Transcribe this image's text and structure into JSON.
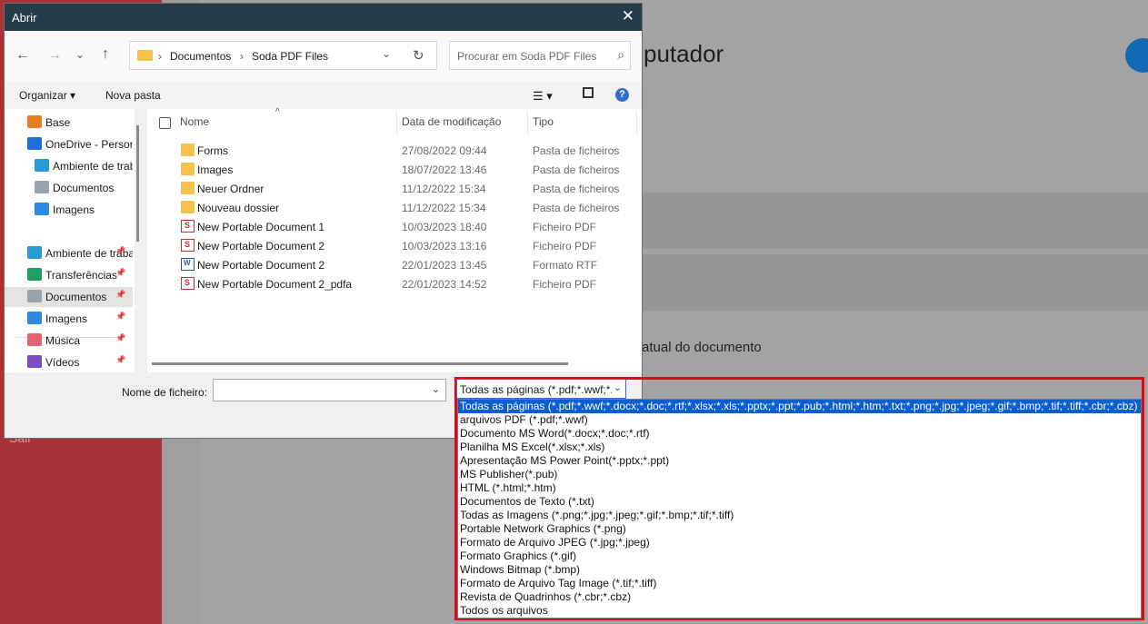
{
  "background": {
    "title_fragment": "putador",
    "text_fragment": "atual do documento",
    "sidebar_fragment": "Sair",
    "accent": "#a8323a",
    "button_color": "#1469b4"
  },
  "dialog": {
    "title": "Abrir",
    "close_icon": "close-icon",
    "breadcrumb": [
      "Documentos",
      "Soda PDF Files"
    ],
    "search_placeholder": "Procurar em Soda PDF Files",
    "commands": {
      "organize": "Organizar ▾",
      "new_folder": "Nova pasta",
      "help": "?"
    },
    "nav_items": [
      {
        "label": "Base",
        "icon": "home-icon",
        "color": "#e67e22",
        "pinned": false
      },
      {
        "label": "OneDrive - Personal",
        "icon": "onedrive-icon",
        "color": "#1e6fd9",
        "pinned": false
      },
      {
        "label": "Ambiente de trabalho",
        "icon": "desktop-icon",
        "color": "#2a9ad6",
        "pinned": false
      },
      {
        "label": "Documentos",
        "icon": "documents-icon",
        "color": "#9aa3ad",
        "pinned": false
      },
      {
        "label": "Imagens",
        "icon": "images-icon",
        "color": "#2a8ae0",
        "pinned": false
      },
      {
        "label": "Ambiente de trabalho",
        "icon": "desktop-icon",
        "color": "#2a9ad6",
        "pinned": true
      },
      {
        "label": "Transferências",
        "icon": "download-icon",
        "color": "#1f9e63",
        "pinned": true
      },
      {
        "label": "Documentos",
        "icon": "documents-icon",
        "color": "#9aa3ad",
        "pinned": true,
        "selected": true
      },
      {
        "label": "Imagens",
        "icon": "images-icon",
        "color": "#2a8ae0",
        "pinned": true
      },
      {
        "label": "Música",
        "icon": "music-icon",
        "color": "#e4626f",
        "pinned": true
      },
      {
        "label": "Vídeos",
        "icon": "videos-icon",
        "color": "#7b4cc4",
        "pinned": true
      }
    ],
    "columns": {
      "name": "Nome",
      "date": "Data de modificação",
      "type": "Tipo"
    },
    "files": [
      {
        "name": "Forms",
        "date": "27/08/2022 09:44",
        "type": "Pasta de ficheiros",
        "icon": "folder"
      },
      {
        "name": "Images",
        "date": "18/07/2022 13:46",
        "type": "Pasta de ficheiros",
        "icon": "folder"
      },
      {
        "name": "Neuer Ordner",
        "date": "11/12/2022 15:34",
        "type": "Pasta de ficheiros",
        "icon": "folder"
      },
      {
        "name": "Nouveau dossier",
        "date": "11/12/2022 15:34",
        "type": "Pasta de ficheiros",
        "icon": "folder"
      },
      {
        "name": "New Portable Document 1",
        "date": "10/03/2023 18:40",
        "type": "Ficheiro PDF",
        "icon": "pdf"
      },
      {
        "name": "New Portable Document 2",
        "date": "10/03/2023 13:16",
        "type": "Ficheiro PDF",
        "icon": "pdf"
      },
      {
        "name": "New Portable Document 2",
        "date": "22/01/2023 13:45",
        "type": "Formato RTF",
        "icon": "rtf"
      },
      {
        "name": "New Portable Document 2_pdfa",
        "date": "22/01/2023 14:52",
        "type": "Ficheiro PDF",
        "icon": "pdf"
      }
    ],
    "filename_label": "Nome de ficheiro:",
    "filename_value": "",
    "filter_value": "Todas as páginas (*.pdf;*.wwf;*.",
    "filter_options": [
      "Todas as páginas (*.pdf;*.wwf;*.docx;*.doc;*.rtf;*.xlsx;*.xls;*.pptx;*.ppt;*.pub;*.html;*.htm;*.txt;*.png;*.jpg;*.jpeg;*.gif;*.bmp;*.tif;*.tiff;*.cbr;*.cbz)",
      "arquivos PDF (*.pdf;*.wwf)",
      "Documento MS Word(*.docx;*.doc;*.rtf)",
      "Planilha MS Excel(*.xlsx;*.xls)",
      "Apresentação MS Power Point(*.pptx;*.ppt)",
      "MS Publisher(*.pub)",
      "HTML (*.html;*.htm)",
      "Documentos de Texto (*.txt)",
      "Todas as Imagens (*.png;*.jpg;*.jpeg;*.gif;*.bmp;*.tif;*.tiff)",
      "Portable Network Graphics (*.png)",
      "Formato de Arquivo JPEG (*.jpg;*.jpeg)",
      "Formato Graphics (*.gif)",
      "Windows Bitmap (*.bmp)",
      "Formato de Arquivo Tag Image (*.tif;*.tiff)",
      "Revista de Quadrinhos (*.cbr;*.cbz)",
      "Todos os arquivos"
    ],
    "selected_filter_index": 0
  }
}
